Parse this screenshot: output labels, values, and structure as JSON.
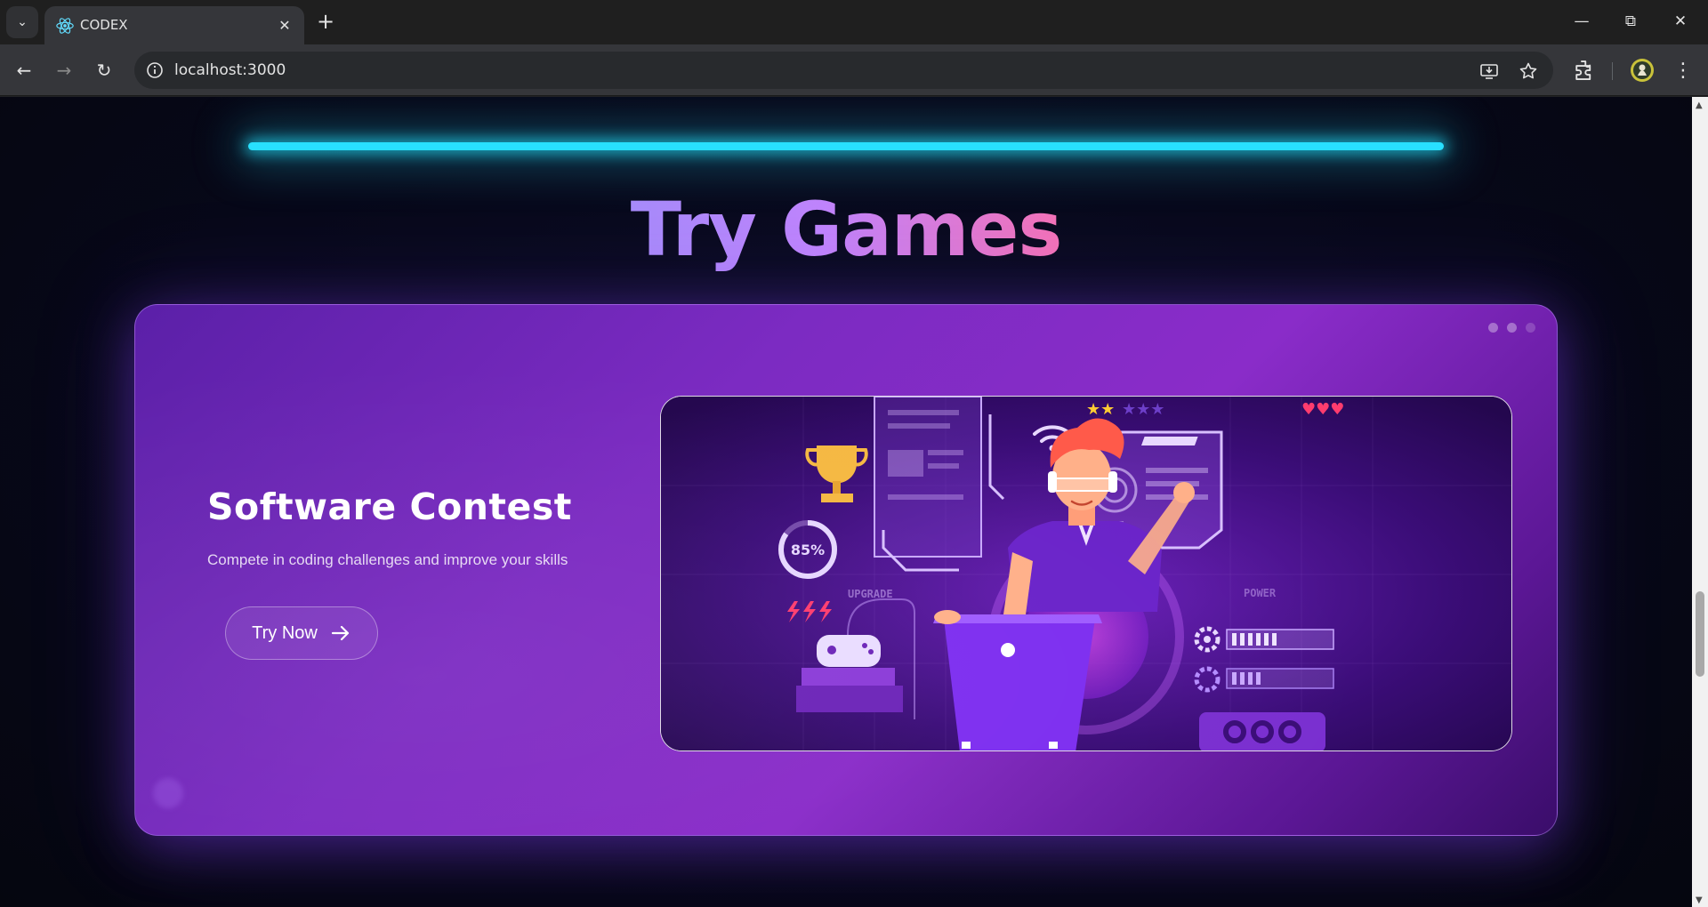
{
  "browser": {
    "tab_title": "CODEX",
    "url": "localhost:3000"
  },
  "page": {
    "section_title": "Try Games",
    "card": {
      "title": "Software Contest",
      "subtitle": "Compete in coding challenges and improve your skills",
      "button_label": "Try Now",
      "carousel_dots": 3,
      "active_dot": 0
    },
    "illustration": {
      "progress_label": "85%",
      "upgrade_label": "UPGRADE",
      "power_label": "POWER"
    }
  },
  "colors": {
    "accent_cyan": "#22d3ee",
    "title_gradient_start": "#a78bfa",
    "title_gradient_end": "#f472b6",
    "card_purple": "#7c2bc2"
  },
  "icons": [
    "tab-list-icon",
    "react-logo-icon",
    "close-icon",
    "plus-icon",
    "minimize-icon",
    "restore-icon",
    "window-close-icon",
    "back-icon",
    "forward-icon",
    "reload-icon",
    "site-info-icon",
    "install-app-icon",
    "bookmark-star-icon",
    "extensions-icon",
    "profile-avatar-icon",
    "menu-icon",
    "arrow-right-icon"
  ]
}
